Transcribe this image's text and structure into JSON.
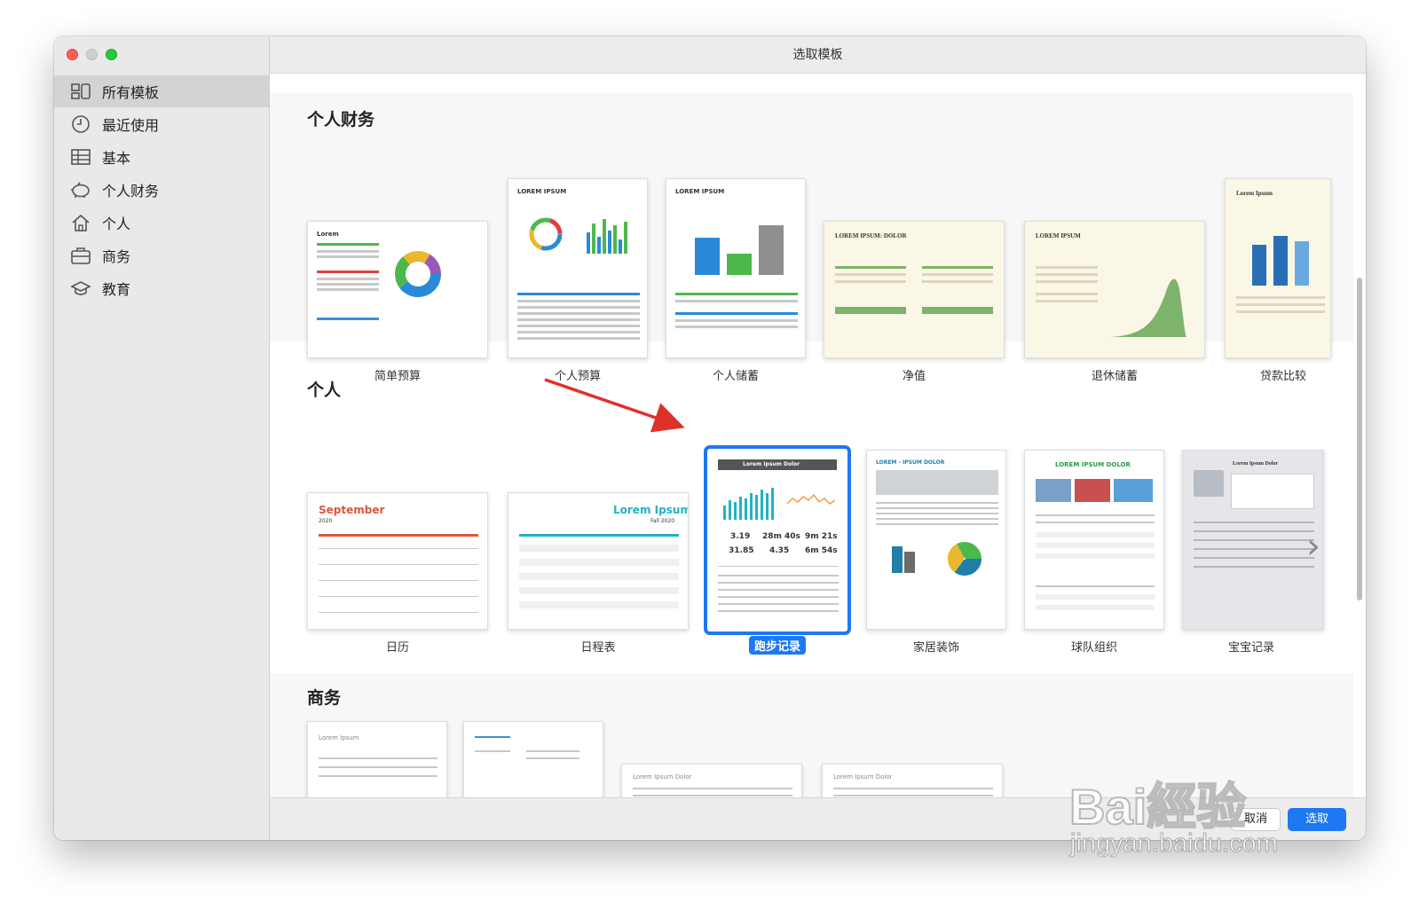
{
  "window": {
    "title": "选取模板"
  },
  "sidebar": {
    "items": [
      {
        "label": "所有模板",
        "icon": "all-templates-icon",
        "selected": true
      },
      {
        "label": "最近使用",
        "icon": "clock-icon"
      },
      {
        "label": "基本",
        "icon": "table-icon"
      },
      {
        "label": "个人财务",
        "icon": "piggy-bank-icon"
      },
      {
        "label": "个人",
        "icon": "house-icon"
      },
      {
        "label": "商务",
        "icon": "briefcase-icon"
      },
      {
        "label": "教育",
        "icon": "graduation-cap-icon"
      }
    ]
  },
  "sections": [
    {
      "title": "个人财务",
      "templates": [
        "简单预算",
        "个人预算",
        "个人储蓄",
        "净值",
        "退休储蓄",
        "贷款比较"
      ]
    },
    {
      "title": "个人",
      "templates": [
        "日历",
        "日程表",
        "跑步记录",
        "家居装饰",
        "球队组织",
        "宝宝记录"
      ],
      "selected": "跑步记录"
    },
    {
      "title": "商务",
      "templates": []
    }
  ],
  "thumb_text": {
    "lorem": "Lorem",
    "lorem_ipsum_caps": "LOREM IPSUM",
    "lorem_ipsum_dolor_caps": "LOREM IPSUM: DOLOR",
    "lorem_ipsum": "Lorem Ipsum",
    "september": "September",
    "year": "2020",
    "fall": "Fall 2020",
    "lorem_ipsum_dolor": "Lorem Ipsum Dolor",
    "lorem_ipsum_dolor_upper": "LOREM IPSUM DOLOR",
    "lorem_ipsum_dolor_dash": "LOREM - IPSUM DOLOR",
    "run_stats": [
      "3.19",
      "28m 40s",
      "9m 21s",
      "31.85",
      "4.35",
      "6m 54s"
    ]
  },
  "footer": {
    "cancel": "取消",
    "choose": "选取"
  },
  "watermark": {
    "line1": "Bai經验",
    "line2": "jingyan.baidu.com"
  },
  "colors": {
    "accent": "#1d78f2",
    "selected_sidebar": "#d3d3d3",
    "arrow": "#e0302a"
  }
}
